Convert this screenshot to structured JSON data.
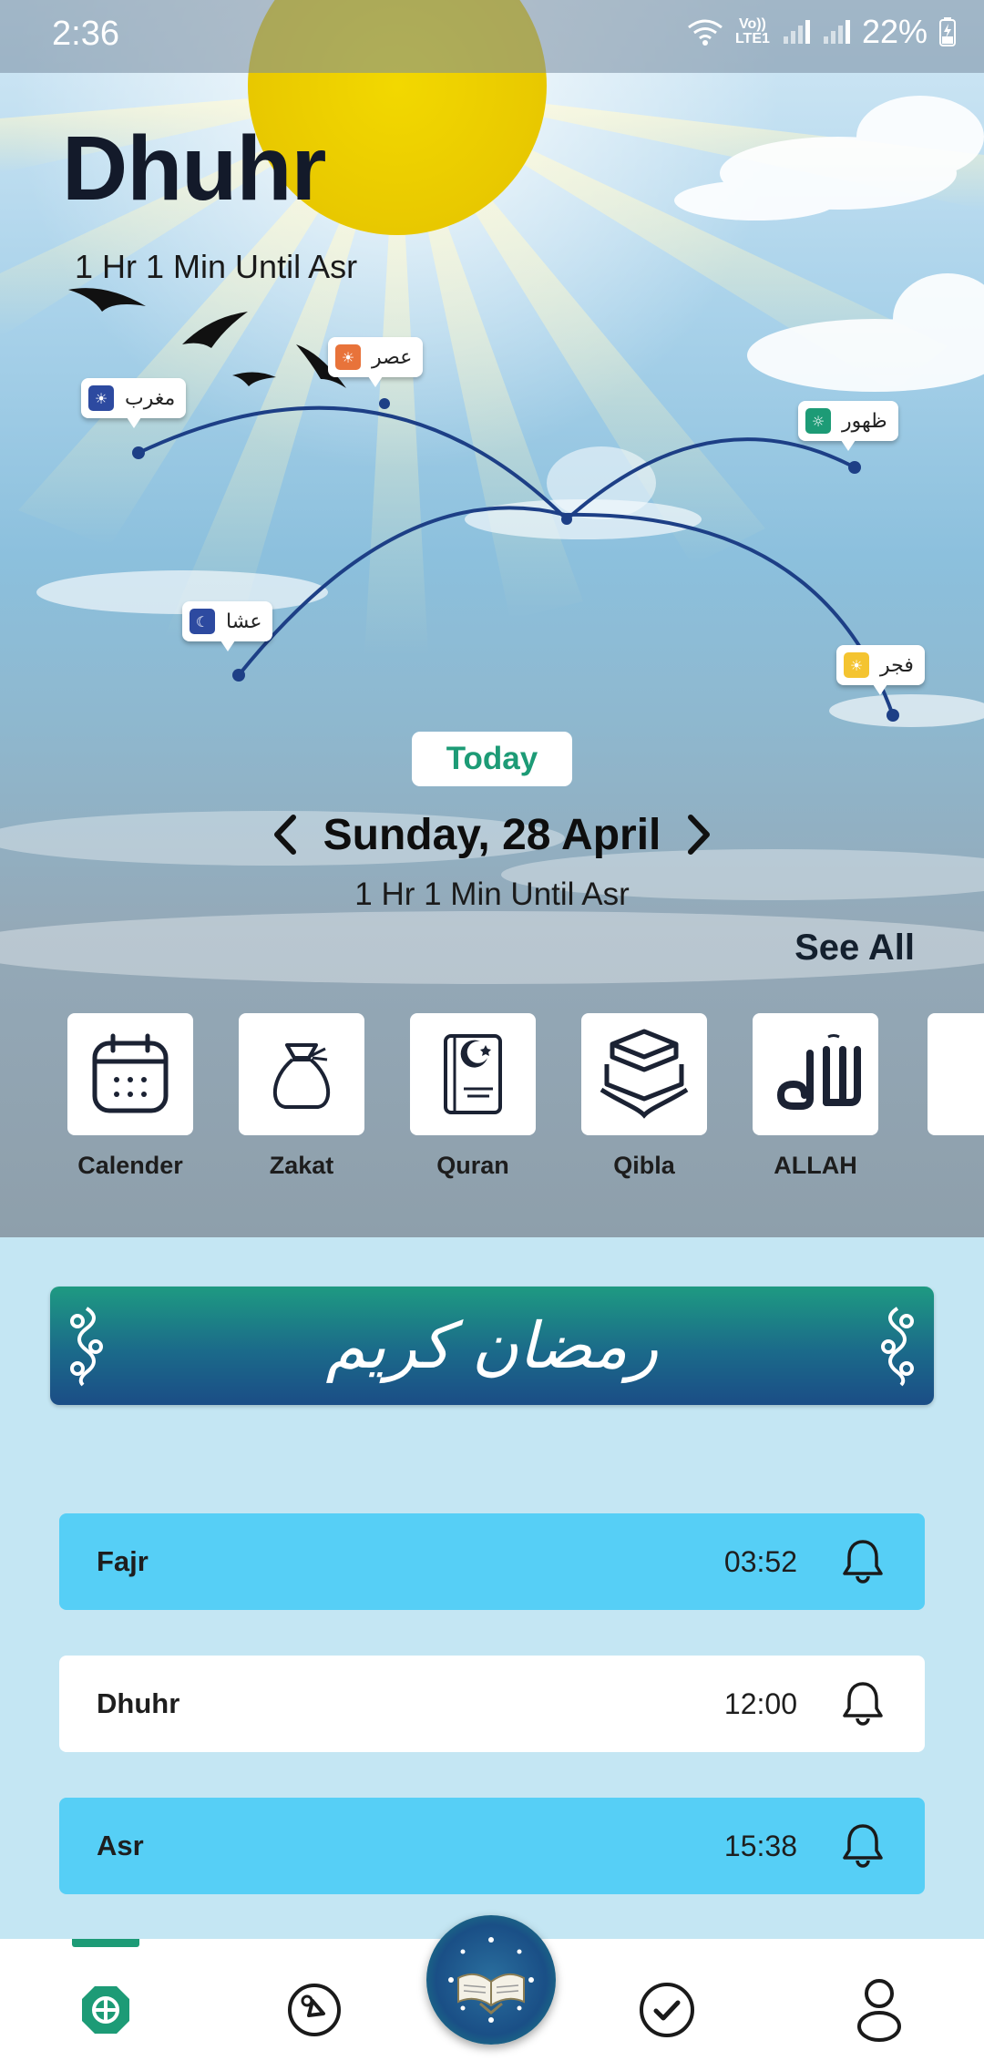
{
  "status_bar": {
    "time": "2:36",
    "network_label": "Vo)) LTE1",
    "battery_percent": "22%"
  },
  "hero": {
    "current_prayer": "Dhuhr",
    "countdown": "1 Hr 1 Min Until Asr",
    "markers": {
      "maghrib": "مغرب",
      "asr": "عصر",
      "dhuhr": "ظهور",
      "isha": "عشا",
      "fajr": "فجر"
    },
    "today_label": "Today",
    "date": "Sunday, 28 April",
    "countdown_secondary": "1 Hr 1 Min Until Asr",
    "see_all": "See All"
  },
  "shortcuts": [
    {
      "label": "Calender",
      "icon": "calendar-icon"
    },
    {
      "label": "Zakat",
      "icon": "money-bag-icon"
    },
    {
      "label": "Quran",
      "icon": "quran-book-icon"
    },
    {
      "label": "Qibla",
      "icon": "kaaba-icon"
    },
    {
      "label": "ALLAH",
      "icon": "allah-calligraphy-icon"
    }
  ],
  "banner": {
    "text": "رمضان كريم"
  },
  "prayer_times": [
    {
      "name": "Fajr",
      "time": "03:52",
      "highlight": true
    },
    {
      "name": "Dhuhr",
      "time": "12:00",
      "highlight": false
    },
    {
      "name": "Asr",
      "time": "15:38",
      "highlight": true
    }
  ],
  "colors": {
    "accent_green": "#1d9b76",
    "row_highlight": "#56cff6",
    "row_plain": "#ffffff",
    "arc_line": "#1d3f86",
    "background_lower": "#c4e6f3"
  },
  "bottom_nav": [
    "home-icon",
    "compass-icon",
    "quran-icon",
    "tasks-check-icon",
    "profile-icon"
  ]
}
